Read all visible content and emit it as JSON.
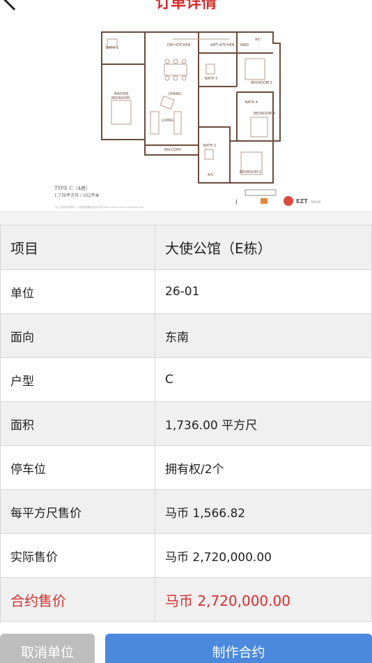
{
  "header": {
    "title": "订单详情",
    "back_icon": "chevron-left-icon"
  },
  "floorplan": {
    "rooms": {
      "bath1": "BATH 1",
      "dry_kitchen": "DRY KITCHEN",
      "wet_kitchen": "WET KITCHEN",
      "yard": "YARD",
      "ac": "A/C",
      "dining": "DINING",
      "bath3": "BATH 3",
      "bedroom3": "BEDROOM 3",
      "master": "MASTER",
      "bedroom_word": "BEDROOM",
      "bath4": "BATH 4",
      "living": "LIVING",
      "bedroom4": "BEDROOM 4",
      "balcony": "BALCONY",
      "bath2": "BATH 2",
      "ac2": "A/C",
      "bedroom2": "BEDROOM 2"
    },
    "type_label": "TYPE C（4房）",
    "area_label": "1,736平方尺 / 162平米",
    "footnote": "*以上资料仅供参考，以发展商最终批准为准 *Sole Construction Drawings Only",
    "logo_text": "EZT",
    "logo_sub": "GROUP"
  },
  "table": {
    "header": {
      "key": "项目",
      "value": "大使公馆（E栋）"
    },
    "rows": [
      {
        "key": "单位",
        "value": "26-01"
      },
      {
        "key": "面向",
        "value": "东南"
      },
      {
        "key": "户型",
        "value": "C"
      },
      {
        "key": "面积",
        "value": "1,736.00 平方尺"
      },
      {
        "key": "停车位",
        "value": "拥有权/2个"
      },
      {
        "key": "每平方尺售价",
        "value": "马币 1,566.82"
      },
      {
        "key": "实际售价",
        "value": "马币 2,720,000.00"
      }
    ],
    "highlight": {
      "key": "合约售价",
      "value": "马币 2,720,000.00"
    }
  },
  "actions": {
    "cancel_label": "取消单位",
    "contract_label": "制作合约"
  },
  "colors": {
    "accent_red": "#d42e2e",
    "primary_blue": "#4a89dc",
    "disabled_gray": "#bdbdbd"
  }
}
